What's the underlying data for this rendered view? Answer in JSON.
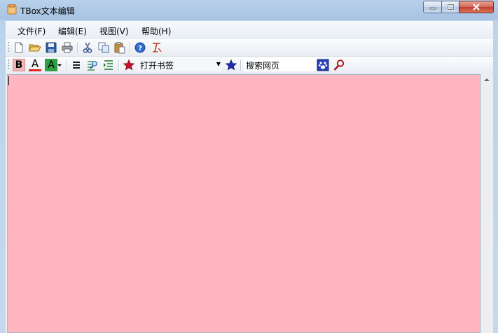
{
  "window": {
    "title": "TBox文本编辑"
  },
  "menu": {
    "items": [
      {
        "label": "文件(F)"
      },
      {
        "label": "编辑(E)"
      },
      {
        "label": "视图(V)"
      },
      {
        "label": "帮助(H)"
      }
    ]
  },
  "toolbar": {
    "icons": [
      "new-file-icon",
      "open-folder-icon",
      "save-icon",
      "print-icon",
      "cut-icon",
      "copy-icon",
      "paste-icon",
      "help-icon",
      "clear-format-icon"
    ]
  },
  "format_toolbar": {
    "bold_label": "B",
    "font_color_label": "A",
    "highlight_label": "A",
    "bookmark_combo_value": "打开书签",
    "search_placeholder": "搜索网页"
  },
  "colors": {
    "editor_background": "#ffb6c1",
    "font_color_underline": "#e0281e",
    "highlight_color": "#2ea043",
    "bookmark_star_red": "#c8102e",
    "bookmark_star_blue": "#1f2bb4"
  }
}
